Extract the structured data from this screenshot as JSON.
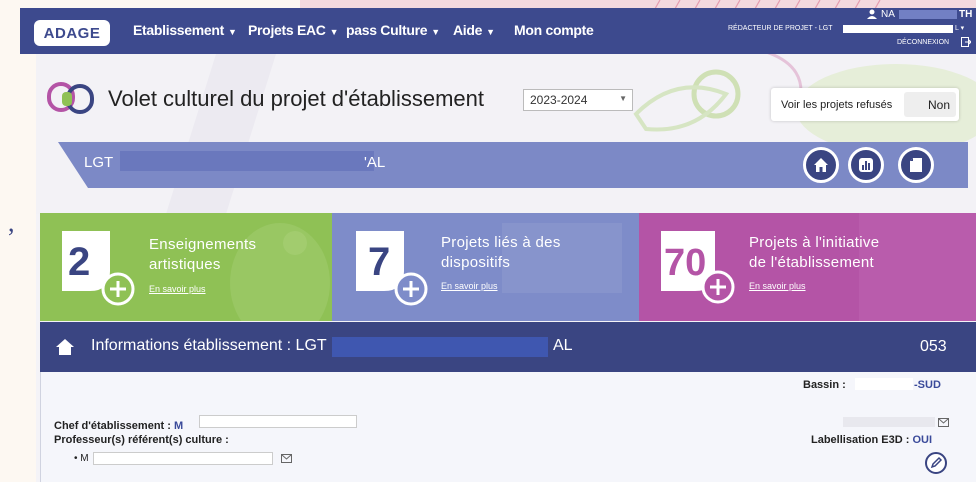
{
  "nav": {
    "logo": "ADAGE",
    "items": [
      {
        "label": "Etablissement",
        "caret": true
      },
      {
        "label": "Projets EAC",
        "caret": true
      },
      {
        "label": "pass Culture",
        "caret": true
      },
      {
        "label": "Aide",
        "caret": true
      },
      {
        "label": "Mon compte",
        "caret": false
      }
    ],
    "user_name_start": "NA",
    "user_name_end": "TH",
    "user_role": "RÉDACTEUR DE PROJET - LGT",
    "user_role_end": "L",
    "logout": "DÉCONNEXION"
  },
  "page": {
    "title": "Volet culturel du projet d'établissement",
    "year_select": "2023-2024",
    "refused_label": "Voir les projets refusés",
    "refused_toggle": "Non"
  },
  "banner": {
    "school_start": "LGT",
    "school_end": "'AL"
  },
  "tiles": [
    {
      "count": "2",
      "title_line1": "Enseignements",
      "title_line2": "artistiques",
      "link": "En savoir plus",
      "color": "#8fc155"
    },
    {
      "count": "7",
      "title_line1": "Projets liés à des",
      "title_line2": "dispositifs",
      "link": "En savoir plus",
      "color": "#7e8cc9"
    },
    {
      "count": "70",
      "title_line1": "Projets à l'initiative",
      "title_line2": "de l'établissement",
      "link": "En savoir plus",
      "color": "#b454a6"
    }
  ],
  "info": {
    "title_start": "Informations établissement : LGT",
    "title_end": "AL",
    "code": "053",
    "bassin_label": "Bassin :",
    "bassin_value": "-SUD",
    "chef_label": "Chef d'établissement :",
    "chef_value": "M",
    "prof_label": "Professeur(s) référent(s) culture :",
    "prof_value": "M",
    "labellisation_label": "Labellisation E3D :",
    "labellisation_value": "OUI"
  },
  "colors": {
    "nav": "#3d4a8e",
    "info_bar": "#3a4582",
    "banner": "#7c89c6"
  },
  "icons": [
    "home-icon",
    "chart-icon",
    "document-icon",
    "edit-icon",
    "mail-icon",
    "user-icon",
    "logout-icon"
  ]
}
